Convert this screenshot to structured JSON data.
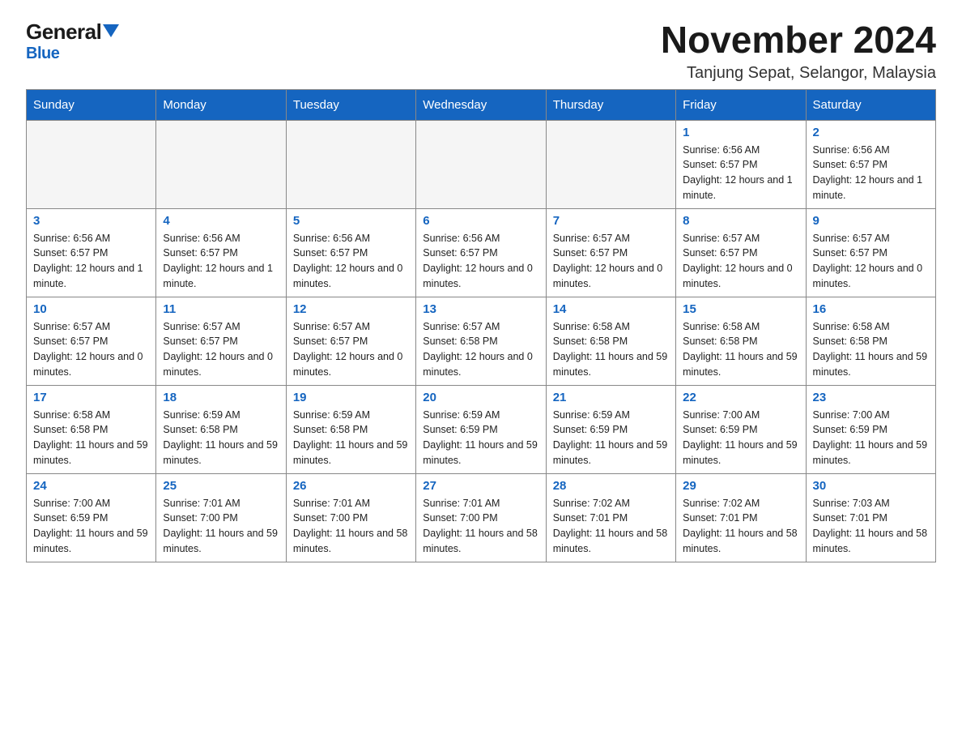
{
  "header": {
    "logo_general": "General",
    "logo_blue": "Blue",
    "month_title": "November 2024",
    "location": "Tanjung Sepat, Selangor, Malaysia"
  },
  "days_of_week": [
    "Sunday",
    "Monday",
    "Tuesday",
    "Wednesday",
    "Thursday",
    "Friday",
    "Saturday"
  ],
  "weeks": [
    [
      {
        "day": "",
        "info": ""
      },
      {
        "day": "",
        "info": ""
      },
      {
        "day": "",
        "info": ""
      },
      {
        "day": "",
        "info": ""
      },
      {
        "day": "",
        "info": ""
      },
      {
        "day": "1",
        "info": "Sunrise: 6:56 AM\nSunset: 6:57 PM\nDaylight: 12 hours and 1 minute."
      },
      {
        "day": "2",
        "info": "Sunrise: 6:56 AM\nSunset: 6:57 PM\nDaylight: 12 hours and 1 minute."
      }
    ],
    [
      {
        "day": "3",
        "info": "Sunrise: 6:56 AM\nSunset: 6:57 PM\nDaylight: 12 hours and 1 minute."
      },
      {
        "day": "4",
        "info": "Sunrise: 6:56 AM\nSunset: 6:57 PM\nDaylight: 12 hours and 1 minute."
      },
      {
        "day": "5",
        "info": "Sunrise: 6:56 AM\nSunset: 6:57 PM\nDaylight: 12 hours and 0 minutes."
      },
      {
        "day": "6",
        "info": "Sunrise: 6:56 AM\nSunset: 6:57 PM\nDaylight: 12 hours and 0 minutes."
      },
      {
        "day": "7",
        "info": "Sunrise: 6:57 AM\nSunset: 6:57 PM\nDaylight: 12 hours and 0 minutes."
      },
      {
        "day": "8",
        "info": "Sunrise: 6:57 AM\nSunset: 6:57 PM\nDaylight: 12 hours and 0 minutes."
      },
      {
        "day": "9",
        "info": "Sunrise: 6:57 AM\nSunset: 6:57 PM\nDaylight: 12 hours and 0 minutes."
      }
    ],
    [
      {
        "day": "10",
        "info": "Sunrise: 6:57 AM\nSunset: 6:57 PM\nDaylight: 12 hours and 0 minutes."
      },
      {
        "day": "11",
        "info": "Sunrise: 6:57 AM\nSunset: 6:57 PM\nDaylight: 12 hours and 0 minutes."
      },
      {
        "day": "12",
        "info": "Sunrise: 6:57 AM\nSunset: 6:57 PM\nDaylight: 12 hours and 0 minutes."
      },
      {
        "day": "13",
        "info": "Sunrise: 6:57 AM\nSunset: 6:58 PM\nDaylight: 12 hours and 0 minutes."
      },
      {
        "day": "14",
        "info": "Sunrise: 6:58 AM\nSunset: 6:58 PM\nDaylight: 11 hours and 59 minutes."
      },
      {
        "day": "15",
        "info": "Sunrise: 6:58 AM\nSunset: 6:58 PM\nDaylight: 11 hours and 59 minutes."
      },
      {
        "day": "16",
        "info": "Sunrise: 6:58 AM\nSunset: 6:58 PM\nDaylight: 11 hours and 59 minutes."
      }
    ],
    [
      {
        "day": "17",
        "info": "Sunrise: 6:58 AM\nSunset: 6:58 PM\nDaylight: 11 hours and 59 minutes."
      },
      {
        "day": "18",
        "info": "Sunrise: 6:59 AM\nSunset: 6:58 PM\nDaylight: 11 hours and 59 minutes."
      },
      {
        "day": "19",
        "info": "Sunrise: 6:59 AM\nSunset: 6:58 PM\nDaylight: 11 hours and 59 minutes."
      },
      {
        "day": "20",
        "info": "Sunrise: 6:59 AM\nSunset: 6:59 PM\nDaylight: 11 hours and 59 minutes."
      },
      {
        "day": "21",
        "info": "Sunrise: 6:59 AM\nSunset: 6:59 PM\nDaylight: 11 hours and 59 minutes."
      },
      {
        "day": "22",
        "info": "Sunrise: 7:00 AM\nSunset: 6:59 PM\nDaylight: 11 hours and 59 minutes."
      },
      {
        "day": "23",
        "info": "Sunrise: 7:00 AM\nSunset: 6:59 PM\nDaylight: 11 hours and 59 minutes."
      }
    ],
    [
      {
        "day": "24",
        "info": "Sunrise: 7:00 AM\nSunset: 6:59 PM\nDaylight: 11 hours and 59 minutes."
      },
      {
        "day": "25",
        "info": "Sunrise: 7:01 AM\nSunset: 7:00 PM\nDaylight: 11 hours and 59 minutes."
      },
      {
        "day": "26",
        "info": "Sunrise: 7:01 AM\nSunset: 7:00 PM\nDaylight: 11 hours and 58 minutes."
      },
      {
        "day": "27",
        "info": "Sunrise: 7:01 AM\nSunset: 7:00 PM\nDaylight: 11 hours and 58 minutes."
      },
      {
        "day": "28",
        "info": "Sunrise: 7:02 AM\nSunset: 7:01 PM\nDaylight: 11 hours and 58 minutes."
      },
      {
        "day": "29",
        "info": "Sunrise: 7:02 AM\nSunset: 7:01 PM\nDaylight: 11 hours and 58 minutes."
      },
      {
        "day": "30",
        "info": "Sunrise: 7:03 AM\nSunset: 7:01 PM\nDaylight: 11 hours and 58 minutes."
      }
    ]
  ]
}
